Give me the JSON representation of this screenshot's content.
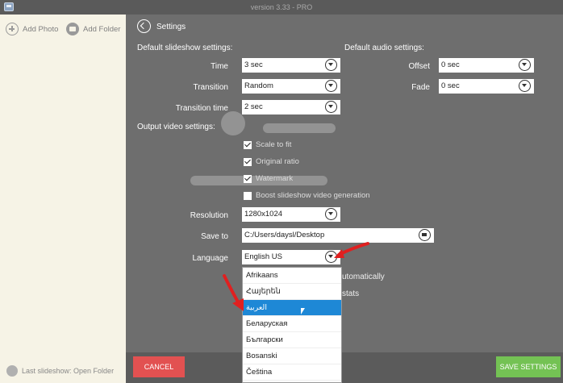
{
  "titlebar": {
    "title": "version 3.33 - PRO"
  },
  "left_panel": {
    "add_photo": "Add Photo",
    "add_folder": "Add Folder",
    "last_slideshow": "Last slideshow: Open Folder"
  },
  "settings": {
    "title": "Settings",
    "slideshow_section": "Default slideshow settings:",
    "audio_section": "Default audio settings:",
    "output_section": "Output video settings:",
    "time": {
      "label": "Time",
      "value": "3 sec"
    },
    "transition": {
      "label": "Transition",
      "value": "Random"
    },
    "transition_time": {
      "label": "Transition time",
      "value": "2 sec"
    },
    "offset": {
      "label": "Offset",
      "value": "0 sec"
    },
    "fade": {
      "label": "Fade",
      "value": "0 sec"
    },
    "checkboxes": [
      {
        "label": "Scale to fit",
        "checked": true
      },
      {
        "label": "Original ratio",
        "checked": true
      },
      {
        "label": "Watermark",
        "checked": true
      },
      {
        "label": "Boost slideshow video generation",
        "checked": false
      }
    ],
    "resolution": {
      "label": "Resolution",
      "value": "1280x1024"
    },
    "save_to": {
      "label": "Save to",
      "value": "C:/Users/daysl/Desktop"
    },
    "language": {
      "label": "Language",
      "value": "English US"
    },
    "partial_automatically": "utomatically",
    "partial_stats": "stats"
  },
  "language_options": [
    "Afrikaans",
    "Հայերեն",
    "العربية",
    "Беларуская",
    "Български",
    "Bosanski",
    "Čeština"
  ],
  "selected_language_index": 2,
  "buttons": {
    "cancel": "CANCEL",
    "save": "SAVE SETTINGS"
  },
  "colors": {
    "cancel": "#e25151",
    "save": "#74c254",
    "selected": "#1e88d6",
    "arrow": "#e02020"
  }
}
